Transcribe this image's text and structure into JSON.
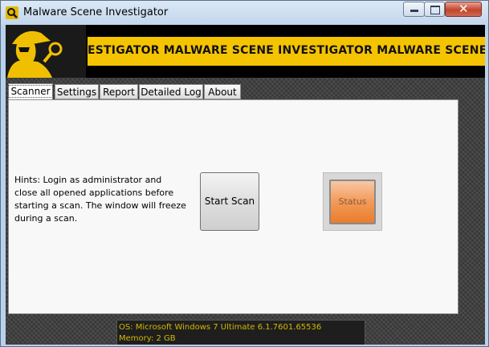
{
  "window": {
    "title": "Malware Scene Investigator"
  },
  "banner": {
    "marquee_text": "ESTIGATOR   MALWARE SCENE INVESTIGATOR   MALWARE SCENE INV"
  },
  "tabs": [
    {
      "label": "Scanner"
    },
    {
      "label": "Settings"
    },
    {
      "label": "Report"
    },
    {
      "label": "Detailed Log"
    },
    {
      "label": "About"
    }
  ],
  "scanner": {
    "hints": "Hints: Login as administrator and close all opened applications before starting a scan. The window will freeze during a scan.",
    "start_scan_label": "Start Scan",
    "status_label": "Status"
  },
  "sysinfo": {
    "os": "OS: Microsoft Windows 7 Ultimate  6.1.7601.65536",
    "memory": "Memory: 2 GB"
  },
  "colors": {
    "accent": "#f5c400",
    "status": "#f29a57"
  }
}
